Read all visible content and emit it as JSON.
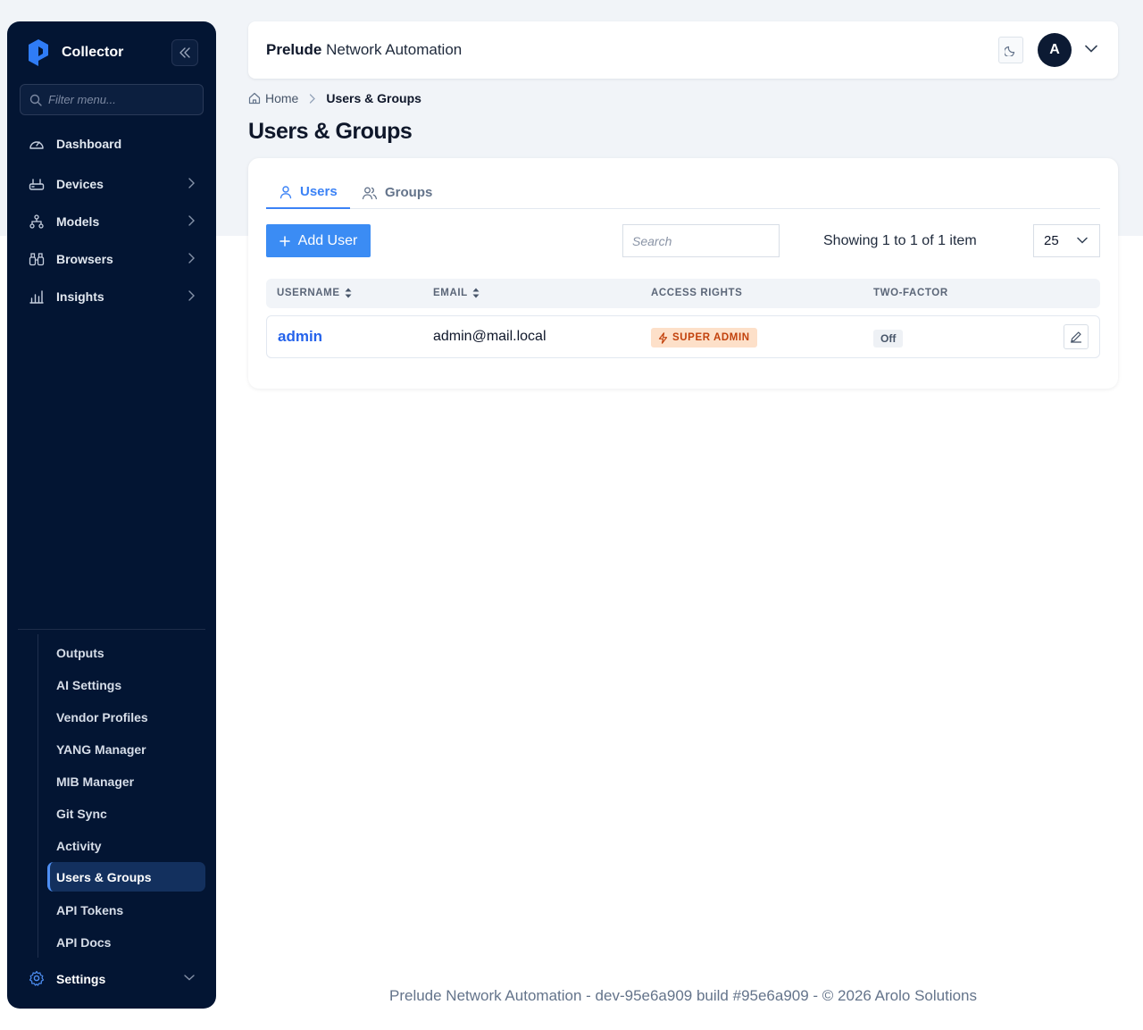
{
  "sidebar": {
    "brand": "Collector",
    "filter_placeholder": "Filter menu...",
    "items": [
      {
        "label": "Dashboard"
      },
      {
        "label": "Devices"
      },
      {
        "label": "Models"
      },
      {
        "label": "Browsers"
      },
      {
        "label": "Insights"
      }
    ],
    "sub_items": [
      {
        "label": "Outputs"
      },
      {
        "label": "AI Settings"
      },
      {
        "label": "Vendor Profiles"
      },
      {
        "label": "YANG Manager"
      },
      {
        "label": "MIB Manager"
      },
      {
        "label": "Git Sync"
      },
      {
        "label": "Activity"
      },
      {
        "label": "Users & Groups",
        "active": true
      },
      {
        "label": "API Tokens"
      },
      {
        "label": "API Docs"
      }
    ],
    "settings_label": "Settings"
  },
  "header": {
    "title_bold": "Prelude",
    "title_rest": "Network Automation",
    "avatar_initial": "A"
  },
  "breadcrumb": {
    "home": "Home",
    "current": "Users & Groups"
  },
  "page": {
    "title": "Users & Groups"
  },
  "tabs": [
    {
      "label": "Users",
      "active": true
    },
    {
      "label": "Groups",
      "active": false
    }
  ],
  "toolbar": {
    "add_label": "Add User",
    "search_placeholder": "Search",
    "showing_text": "Showing 1 to 1 of 1 item",
    "per_page": "25"
  },
  "table": {
    "columns": [
      "USERNAME",
      "EMAIL",
      "ACCESS RIGHTS",
      "TWO-FACTOR"
    ],
    "rows": [
      {
        "username": "admin",
        "email": "admin@mail.local",
        "access": "SUPER ADMIN",
        "two_factor": "Off"
      }
    ]
  },
  "footer": {
    "text": "Prelude Network Automation - dev-95e6a909 build #95e6a909 - © 2026 Arolo Solutions"
  },
  "colors": {
    "sidebar_bg": "#031533",
    "accent": "#3b82f6",
    "super_admin_badge_bg": "#fde0c9",
    "super_admin_badge_text": "#c2410c"
  },
  "icons": {
    "brand": "brand-logo-icon",
    "collapse": "double-chevron-left-icon",
    "filter": "search-icon",
    "dashboard": "gauge-icon",
    "devices": "router-icon",
    "models": "hierarchy-icon",
    "browsers": "binoculars-icon",
    "insights": "bar-chart-icon",
    "settings": "gear-icon",
    "theme": "moon-icon",
    "home": "home-icon",
    "users_tab": "user-icon",
    "groups_tab": "users-icon",
    "add": "plus-icon",
    "sort": "sort-icon",
    "access": "lightning-icon",
    "edit": "pencil-icon"
  }
}
